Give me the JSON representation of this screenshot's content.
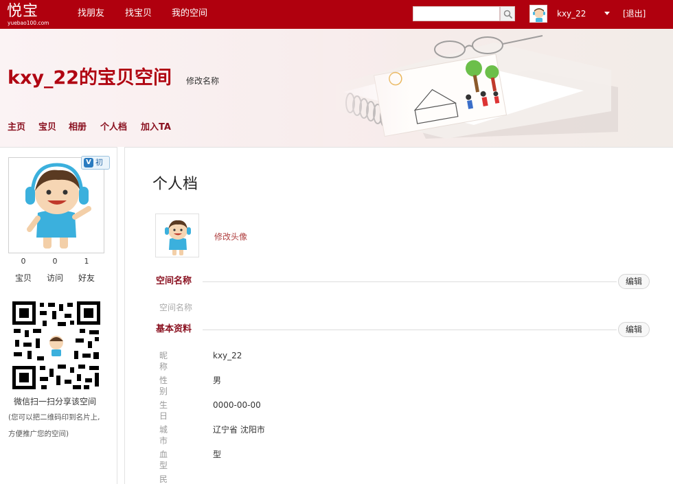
{
  "topbar": {
    "logo_text": "悦宝",
    "logo_sub": "yuebao100.com",
    "nav": [
      "找朋友",
      "找宝贝",
      "我的空间"
    ],
    "search_placeholder": "",
    "username": "kxy_22",
    "logout": "[退出]",
    "bg_color": "#b0000e"
  },
  "banner": {
    "space_title": "kxy_22的宝贝空间",
    "rename": "修改名称",
    "nav": [
      "主页",
      "宝贝",
      "相册",
      "个人档",
      "加入TA"
    ]
  },
  "sidebar": {
    "badge_v": "V",
    "badge_level": "初",
    "stats": [
      {
        "value": "0",
        "label": "宝贝"
      },
      {
        "value": "0",
        "label": "访问"
      },
      {
        "value": "1",
        "label": "好友"
      }
    ],
    "qr_caption": "微信扫一扫分享该空间",
    "qr_note_1": "(您可以把二维码印到名片上,",
    "qr_note_2": "方便推广您的空间)"
  },
  "main": {
    "title": "个人档",
    "change_avatar": "修改头像",
    "sections": [
      {
        "title": "空间名称",
        "edit": "编辑"
      },
      {
        "title": "基本资料",
        "edit": "编辑"
      }
    ],
    "space_name_hint": "空间名称",
    "fields": [
      {
        "label": "昵称",
        "value": "kxy_22"
      },
      {
        "label": "性别",
        "value": "男"
      },
      {
        "label": "生日",
        "value": "0000-00-00"
      },
      {
        "label": "城市",
        "value": "辽宁省 沈阳市"
      },
      {
        "label": "血型",
        "value": "型"
      },
      {
        "label": "民族",
        "value": ""
      }
    ]
  }
}
